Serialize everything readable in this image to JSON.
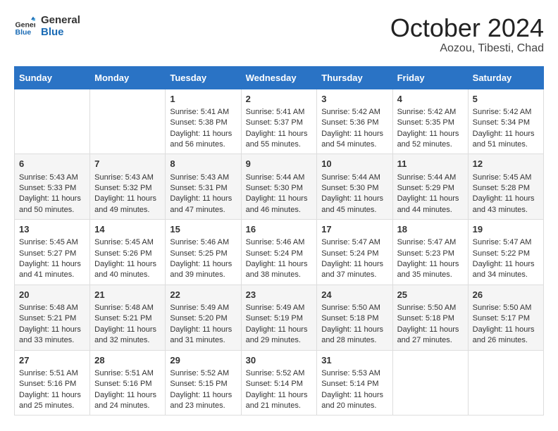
{
  "header": {
    "logo_line1": "General",
    "logo_line2": "Blue",
    "month": "October 2024",
    "location": "Aozou, Tibesti, Chad"
  },
  "days_of_week": [
    "Sunday",
    "Monday",
    "Tuesday",
    "Wednesday",
    "Thursday",
    "Friday",
    "Saturday"
  ],
  "weeks": [
    [
      {
        "day": "",
        "sunrise": "",
        "sunset": "",
        "daylight": ""
      },
      {
        "day": "",
        "sunrise": "",
        "sunset": "",
        "daylight": ""
      },
      {
        "day": "1",
        "sunrise": "Sunrise: 5:41 AM",
        "sunset": "Sunset: 5:38 PM",
        "daylight": "Daylight: 11 hours and 56 minutes."
      },
      {
        "day": "2",
        "sunrise": "Sunrise: 5:41 AM",
        "sunset": "Sunset: 5:37 PM",
        "daylight": "Daylight: 11 hours and 55 minutes."
      },
      {
        "day": "3",
        "sunrise": "Sunrise: 5:42 AM",
        "sunset": "Sunset: 5:36 PM",
        "daylight": "Daylight: 11 hours and 54 minutes."
      },
      {
        "day": "4",
        "sunrise": "Sunrise: 5:42 AM",
        "sunset": "Sunset: 5:35 PM",
        "daylight": "Daylight: 11 hours and 52 minutes."
      },
      {
        "day": "5",
        "sunrise": "Sunrise: 5:42 AM",
        "sunset": "Sunset: 5:34 PM",
        "daylight": "Daylight: 11 hours and 51 minutes."
      }
    ],
    [
      {
        "day": "6",
        "sunrise": "Sunrise: 5:43 AM",
        "sunset": "Sunset: 5:33 PM",
        "daylight": "Daylight: 11 hours and 50 minutes."
      },
      {
        "day": "7",
        "sunrise": "Sunrise: 5:43 AM",
        "sunset": "Sunset: 5:32 PM",
        "daylight": "Daylight: 11 hours and 49 minutes."
      },
      {
        "day": "8",
        "sunrise": "Sunrise: 5:43 AM",
        "sunset": "Sunset: 5:31 PM",
        "daylight": "Daylight: 11 hours and 47 minutes."
      },
      {
        "day": "9",
        "sunrise": "Sunrise: 5:44 AM",
        "sunset": "Sunset: 5:30 PM",
        "daylight": "Daylight: 11 hours and 46 minutes."
      },
      {
        "day": "10",
        "sunrise": "Sunrise: 5:44 AM",
        "sunset": "Sunset: 5:30 PM",
        "daylight": "Daylight: 11 hours and 45 minutes."
      },
      {
        "day": "11",
        "sunrise": "Sunrise: 5:44 AM",
        "sunset": "Sunset: 5:29 PM",
        "daylight": "Daylight: 11 hours and 44 minutes."
      },
      {
        "day": "12",
        "sunrise": "Sunrise: 5:45 AM",
        "sunset": "Sunset: 5:28 PM",
        "daylight": "Daylight: 11 hours and 43 minutes."
      }
    ],
    [
      {
        "day": "13",
        "sunrise": "Sunrise: 5:45 AM",
        "sunset": "Sunset: 5:27 PM",
        "daylight": "Daylight: 11 hours and 41 minutes."
      },
      {
        "day": "14",
        "sunrise": "Sunrise: 5:45 AM",
        "sunset": "Sunset: 5:26 PM",
        "daylight": "Daylight: 11 hours and 40 minutes."
      },
      {
        "day": "15",
        "sunrise": "Sunrise: 5:46 AM",
        "sunset": "Sunset: 5:25 PM",
        "daylight": "Daylight: 11 hours and 39 minutes."
      },
      {
        "day": "16",
        "sunrise": "Sunrise: 5:46 AM",
        "sunset": "Sunset: 5:24 PM",
        "daylight": "Daylight: 11 hours and 38 minutes."
      },
      {
        "day": "17",
        "sunrise": "Sunrise: 5:47 AM",
        "sunset": "Sunset: 5:24 PM",
        "daylight": "Daylight: 11 hours and 37 minutes."
      },
      {
        "day": "18",
        "sunrise": "Sunrise: 5:47 AM",
        "sunset": "Sunset: 5:23 PM",
        "daylight": "Daylight: 11 hours and 35 minutes."
      },
      {
        "day": "19",
        "sunrise": "Sunrise: 5:47 AM",
        "sunset": "Sunset: 5:22 PM",
        "daylight": "Daylight: 11 hours and 34 minutes."
      }
    ],
    [
      {
        "day": "20",
        "sunrise": "Sunrise: 5:48 AM",
        "sunset": "Sunset: 5:21 PM",
        "daylight": "Daylight: 11 hours and 33 minutes."
      },
      {
        "day": "21",
        "sunrise": "Sunrise: 5:48 AM",
        "sunset": "Sunset: 5:21 PM",
        "daylight": "Daylight: 11 hours and 32 minutes."
      },
      {
        "day": "22",
        "sunrise": "Sunrise: 5:49 AM",
        "sunset": "Sunset: 5:20 PM",
        "daylight": "Daylight: 11 hours and 31 minutes."
      },
      {
        "day": "23",
        "sunrise": "Sunrise: 5:49 AM",
        "sunset": "Sunset: 5:19 PM",
        "daylight": "Daylight: 11 hours and 29 minutes."
      },
      {
        "day": "24",
        "sunrise": "Sunrise: 5:50 AM",
        "sunset": "Sunset: 5:18 PM",
        "daylight": "Daylight: 11 hours and 28 minutes."
      },
      {
        "day": "25",
        "sunrise": "Sunrise: 5:50 AM",
        "sunset": "Sunset: 5:18 PM",
        "daylight": "Daylight: 11 hours and 27 minutes."
      },
      {
        "day": "26",
        "sunrise": "Sunrise: 5:50 AM",
        "sunset": "Sunset: 5:17 PM",
        "daylight": "Daylight: 11 hours and 26 minutes."
      }
    ],
    [
      {
        "day": "27",
        "sunrise": "Sunrise: 5:51 AM",
        "sunset": "Sunset: 5:16 PM",
        "daylight": "Daylight: 11 hours and 25 minutes."
      },
      {
        "day": "28",
        "sunrise": "Sunrise: 5:51 AM",
        "sunset": "Sunset: 5:16 PM",
        "daylight": "Daylight: 11 hours and 24 minutes."
      },
      {
        "day": "29",
        "sunrise": "Sunrise: 5:52 AM",
        "sunset": "Sunset: 5:15 PM",
        "daylight": "Daylight: 11 hours and 23 minutes."
      },
      {
        "day": "30",
        "sunrise": "Sunrise: 5:52 AM",
        "sunset": "Sunset: 5:14 PM",
        "daylight": "Daylight: 11 hours and 21 minutes."
      },
      {
        "day": "31",
        "sunrise": "Sunrise: 5:53 AM",
        "sunset": "Sunset: 5:14 PM",
        "daylight": "Daylight: 11 hours and 20 minutes."
      },
      {
        "day": "",
        "sunrise": "",
        "sunset": "",
        "daylight": ""
      },
      {
        "day": "",
        "sunrise": "",
        "sunset": "",
        "daylight": ""
      }
    ]
  ]
}
